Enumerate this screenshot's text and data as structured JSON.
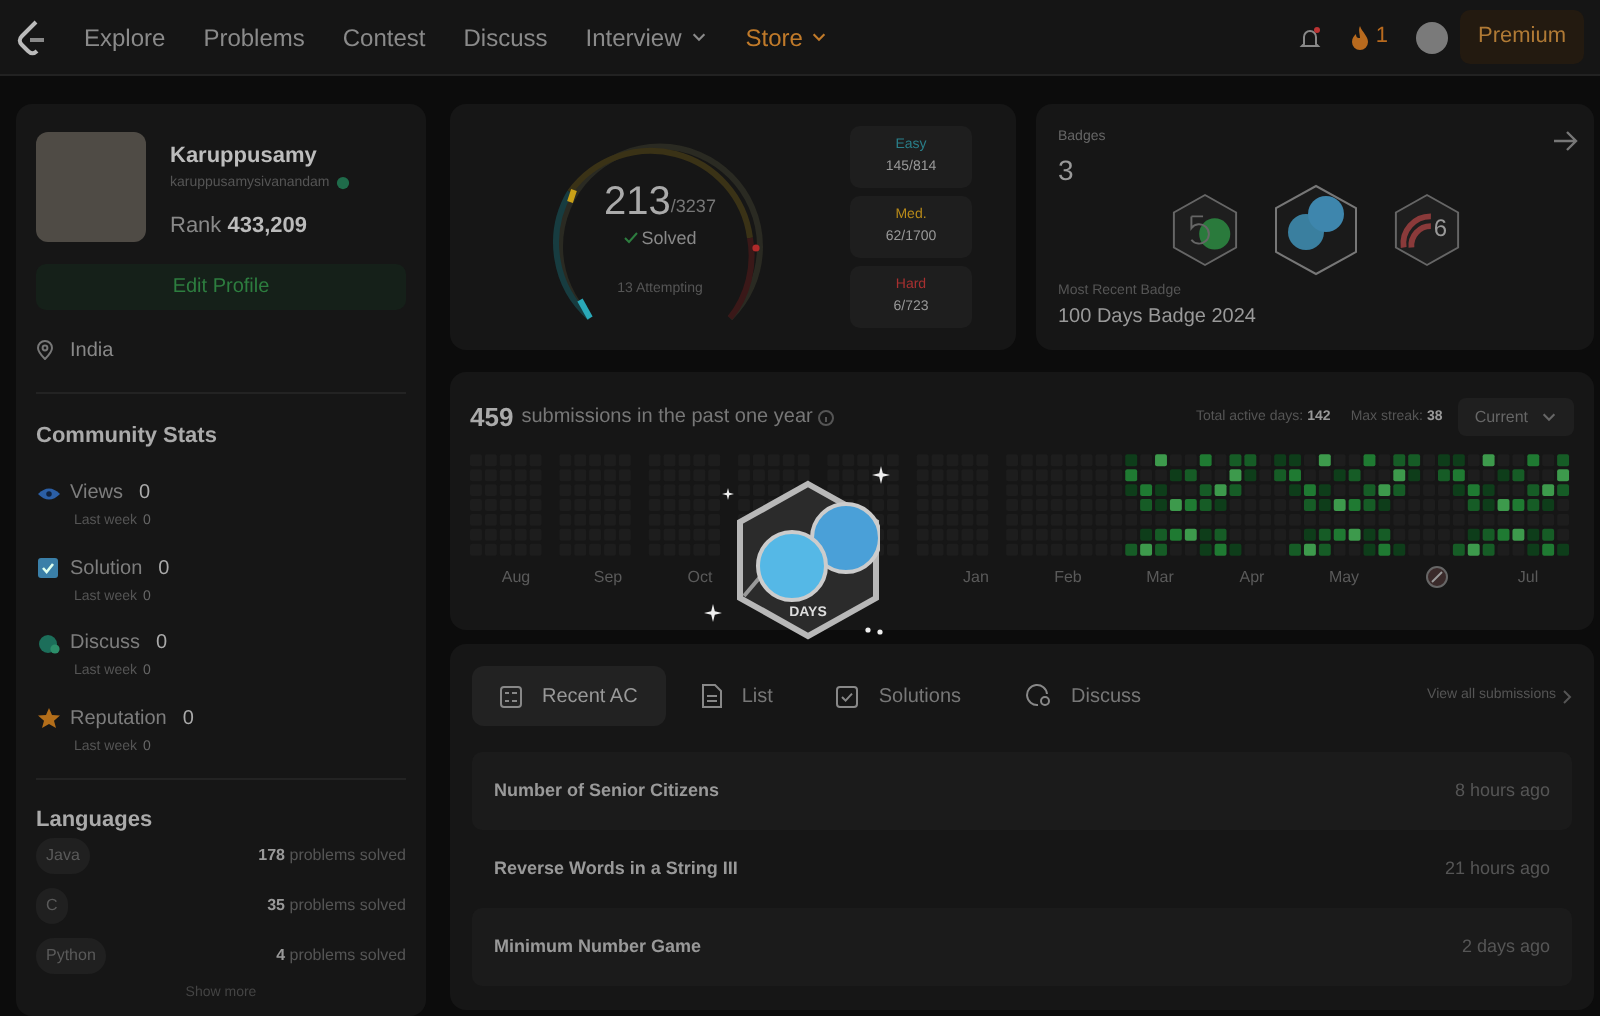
{
  "nav": {
    "items": [
      {
        "label": "Explore",
        "dropdown": false,
        "highlight": false
      },
      {
        "label": "Problems",
        "dropdown": false,
        "highlight": false
      },
      {
        "label": "Contest",
        "dropdown": false,
        "highlight": false
      },
      {
        "label": "Discuss",
        "dropdown": false,
        "highlight": false
      },
      {
        "label": "Interview",
        "dropdown": true,
        "highlight": false
      },
      {
        "label": "Store",
        "dropdown": true,
        "highlight": true
      }
    ],
    "streak": "1",
    "premium": "Premium"
  },
  "profile": {
    "name": "Karuppusamy",
    "username": "karuppusamysivanandam",
    "rank_label": "Rank",
    "rank": "433,209",
    "edit_button": "Edit Profile",
    "location": "India"
  },
  "community": {
    "title": "Community Stats",
    "stats": [
      {
        "kind": "views",
        "label": "Views",
        "value": "0",
        "sub": "Last week",
        "sub_value": "0"
      },
      {
        "kind": "solution",
        "label": "Solution",
        "value": "0",
        "sub": "Last week",
        "sub_value": "0"
      },
      {
        "kind": "discuss",
        "label": "Discuss",
        "value": "0",
        "sub": "Last week",
        "sub_value": "0"
      },
      {
        "kind": "reputation",
        "label": "Reputation",
        "value": "0",
        "sub": "Last week",
        "sub_value": "0"
      }
    ]
  },
  "languages": {
    "title": "Languages",
    "items": [
      {
        "name": "Java",
        "count": "178",
        "suffix": "problems solved"
      },
      {
        "name": "C",
        "count": "35",
        "suffix": "problems solved"
      },
      {
        "name": "Python",
        "count": "4",
        "suffix": "problems solved"
      }
    ],
    "more": "Show more"
  },
  "solved": {
    "count": "213",
    "total": "/3237",
    "label": "Solved",
    "attempting": "13 Attempting",
    "levels": [
      {
        "kind": "easy",
        "label": "Easy",
        "value": "145/814"
      },
      {
        "kind": "medium",
        "label": "Med.",
        "value": "62/1700"
      },
      {
        "kind": "hard",
        "label": "Hard",
        "value": "6/723"
      }
    ]
  },
  "badges": {
    "title": "Badges",
    "count": "3",
    "recent_label": "Most Recent Badge",
    "recent": "100 Days Badge 2024",
    "items": [
      {
        "kind": "fifty"
      },
      {
        "kind": "hundred"
      },
      {
        "kind": "june",
        "text": "6"
      }
    ]
  },
  "heatmap": {
    "count": "459",
    "caption": "submissions in the past one year",
    "active_label": "Total active days:",
    "active": "142",
    "streak_label": "Max streak:",
    "streak": "38",
    "select": "Current",
    "months_early": [
      "Aug",
      "Sep",
      "Oct"
    ],
    "months_late": [
      "Jan",
      "Feb",
      "Mar",
      "Apr",
      "May"
    ],
    "months_last": [
      "Jul"
    ]
  },
  "overlay_badge": {
    "text": "DAYS"
  },
  "recent": {
    "tabs": [
      {
        "kind": "ac",
        "label": "Recent AC",
        "selected": true
      },
      {
        "kind": "list",
        "label": "List",
        "selected": false
      },
      {
        "kind": "solutions",
        "label": "Solutions",
        "selected": false
      },
      {
        "kind": "discuss",
        "label": "Discuss",
        "selected": false
      }
    ],
    "view_all": "View all submissions",
    "rows": [
      {
        "title": "Number of Senior Citizens",
        "time": "8 hours ago"
      },
      {
        "title": "Reverse Words in a String III",
        "time": "21 hours ago"
      },
      {
        "title": "Minimum Number Game",
        "time": "2 days ago"
      }
    ]
  }
}
